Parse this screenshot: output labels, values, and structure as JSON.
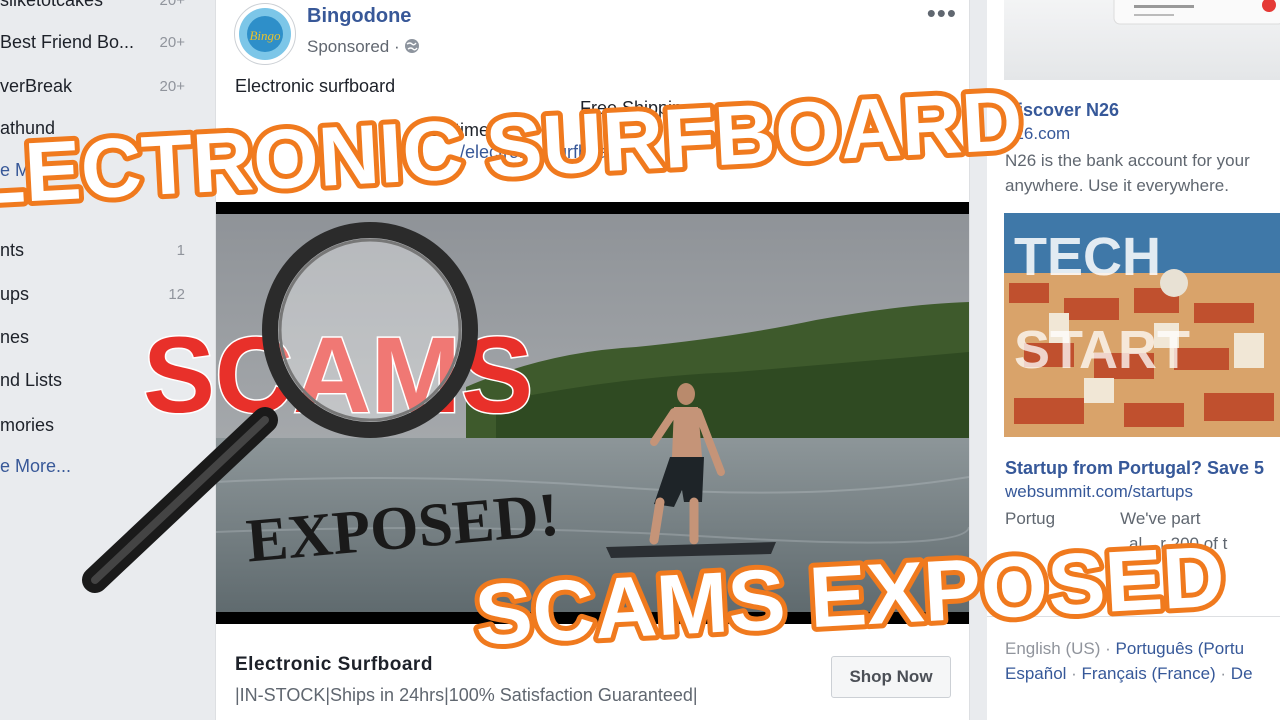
{
  "sidebar": {
    "items": [
      {
        "label": "sliketotcakes",
        "count": "20+"
      },
      {
        "label": "Best Friend Bo...",
        "count": "20+"
      },
      {
        "label": "verBreak",
        "count": "20+"
      },
      {
        "label": "athund",
        "count": ""
      },
      {
        "label": "e More...",
        "count": ""
      },
      {
        "label": "nts",
        "count": "1"
      },
      {
        "label": "ups",
        "count": "12"
      },
      {
        "label": "nes",
        "count": ""
      },
      {
        "label": "nd Lists",
        "count": ""
      },
      {
        "label": "mories",
        "count": ""
      },
      {
        "label": "e More...",
        "count": ""
      }
    ]
  },
  "post": {
    "page_name": "Bingodone",
    "sponsored": "Sponsored · ",
    "avatar_text": "Bingo",
    "line1": "Electronic surfboard",
    "line2": "Free Shippin",
    "line3": "ED time",
    "link": "/electronic-surfboard",
    "footer_title": "Electronic Surfboard",
    "footer_desc": "|IN-STOCK|Ships in 24hrs|100% Satisfaction Guaranteed|",
    "cta": "Shop Now",
    "more_icon": "more-dots-icon",
    "privacy_icon": "globe-icon"
  },
  "right": {
    "ad1": {
      "title": "Discover N26",
      "url": "n26.com",
      "desc": "N26 is the bank account for your anywhere. Use it everywhere."
    },
    "ad2": {
      "title": "Startup from Portugal? Save 5",
      "url": "websummit.com/startups",
      "desc1": "Portug",
      "desc2": "We've part",
      "desc3": "al",
      "desc4": "r 200 of t",
      "image_text1": "TECH",
      "image_text2": "START"
    },
    "languages": {
      "current": "English (US)",
      "l1": "Português (Portu",
      "l2": "Español",
      "l3": "Français (France)",
      "l4": "De"
    }
  },
  "overlay": {
    "top_title": "ELECTRONIC SURFBOARD",
    "scams": "SCAMS",
    "exposed_stamp": "EXPOSED!",
    "bottom_title": "SCAMS EXPOSED"
  },
  "colors": {
    "accent_orange": "#f07a1e",
    "link_blue": "#385898",
    "scam_red": "#e8302a"
  }
}
